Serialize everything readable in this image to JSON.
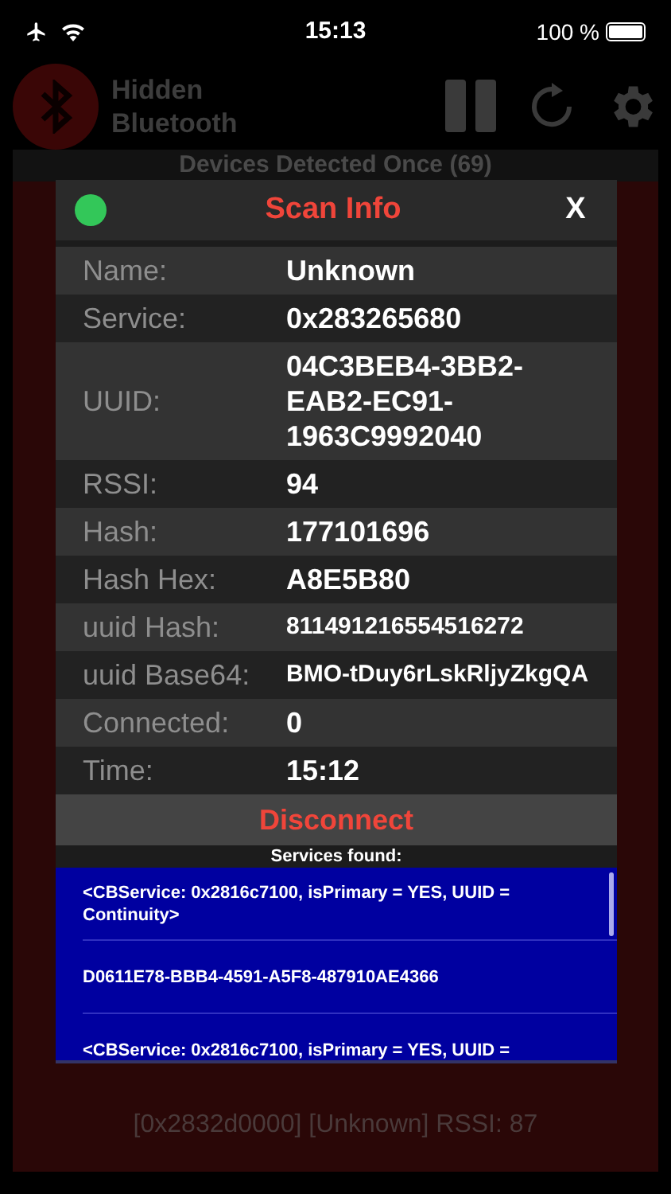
{
  "status_bar": {
    "time": "15:13",
    "battery": "100 %"
  },
  "app": {
    "title": "Hidden Bluetooth",
    "section_header": "Devices Detected Once (69)",
    "device_row": "[0x2832d0000] [Unknown] RSSI: 87"
  },
  "dialog": {
    "title": "Scan Info",
    "connected": true,
    "close": "X",
    "fields": [
      {
        "label": "Name:",
        "value": "Unknown",
        "kind": "normal"
      },
      {
        "label": "Service:",
        "value": "0x283265680",
        "kind": "normal"
      },
      {
        "label": "UUID:",
        "value": "04C3BEB4-3BB2-EAB2-EC91-1963C9992040",
        "kind": "normal"
      },
      {
        "label": "RSSI:",
        "value": "94",
        "kind": "normal"
      },
      {
        "label": "Hash:",
        "value": "177101696",
        "kind": "normal"
      },
      {
        "label": "Hash Hex:",
        "value": "A8E5B80",
        "kind": "normal"
      },
      {
        "label": "uuid Hash:",
        "value": "811491216554516272",
        "kind": "small"
      },
      {
        "label": "uuid Base64:",
        "value": "BMO-tDuy6rLskRljyZkgQA",
        "kind": "small"
      },
      {
        "label": "Connected:",
        "value": "0",
        "kind": "normal"
      },
      {
        "label": "Time:",
        "value": "15:12",
        "kind": "normal"
      }
    ],
    "action": "Disconnect",
    "services_label": "Services found:",
    "services": [
      "<CBService: 0x2816c7100, isPrimary = YES, UUID = Continuity>",
      "D0611E78-BBB4-4591-A5F8-487910AE4366",
      "<CBService: 0x2816c7100, isPrimary = YES, UUID ="
    ]
  }
}
